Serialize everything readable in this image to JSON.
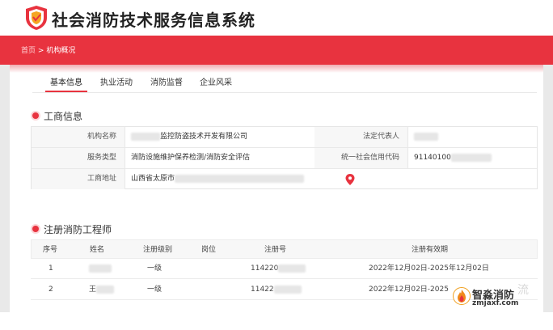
{
  "header": {
    "app_title": "社会消防技术服务信息系统"
  },
  "breadcrumb": {
    "home": "首页",
    "separator": ">",
    "current": "机构概况"
  },
  "tabs": [
    {
      "label": "基本信息",
      "active": true
    },
    {
      "label": "执业活动",
      "active": false
    },
    {
      "label": "消防监督",
      "active": false
    },
    {
      "label": "企业风采",
      "active": false
    }
  ],
  "business_info": {
    "title": "工商信息",
    "rows": [
      {
        "label1": "机构名称",
        "value1": "监控防盗技术开发有限公司",
        "label2": "法定代表人",
        "value2": ""
      },
      {
        "label1": "服务类型",
        "value1": "消防设施维护保养检测/消防安全评估",
        "label2": "统一社会信用代码",
        "value2": "91140100"
      },
      {
        "label1": "工商地址",
        "value1": "山西省太原市"
      }
    ]
  },
  "engineers": {
    "title": "注册消防工程师",
    "columns": [
      "序号",
      "姓名",
      "注册级别",
      "岗位",
      "注册号",
      "注册有效期"
    ],
    "rows": [
      {
        "no": "1",
        "name": "",
        "level": "一级",
        "post": "",
        "reg_no": "114220",
        "validity": "2022年12月02日-2025年12月02日"
      },
      {
        "no": "2",
        "name": "王",
        "level": "一级",
        "post": "",
        "reg_no": "11422",
        "validity": "2022年12月02日-2025"
      }
    ]
  },
  "watermark": {
    "name": "智淼消防",
    "domain": "zmjaxf.com",
    "faded_text": "流"
  },
  "colors": {
    "accent": "#e8333f",
    "label_bg": "#f7f7f7",
    "border": "#e5e5e5"
  },
  "icons": {
    "logo": "shield-icon",
    "location": "map-pin-icon"
  }
}
